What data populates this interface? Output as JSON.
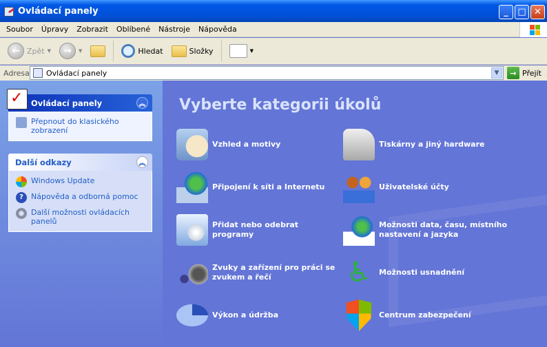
{
  "window": {
    "title": "Ovládací panely"
  },
  "menu": [
    "Soubor",
    "Úpravy",
    "Zobrazit",
    "Oblíbené",
    "Nástroje",
    "Nápověda"
  ],
  "toolbar": {
    "back": "Zpět",
    "search": "Hledat",
    "folders": "Složky"
  },
  "address": {
    "label": "Adresa",
    "value": "Ovládací panely",
    "go": "Přejít"
  },
  "sidebar": {
    "panel1": {
      "title": "Ovládací panely",
      "links": [
        "Přepnout do klasického zobrazení"
      ]
    },
    "panel2": {
      "title": "Další odkazy",
      "links": [
        "Windows Update",
        "Nápověda a odborná pomoc",
        "Další možnosti ovládacích panelů"
      ]
    }
  },
  "main": {
    "title": "Vyberte kategorii úkolů",
    "categories": [
      "Vzhled a motivy",
      "Tiskárny a jiný hardware",
      "Připojení k síti a Internetu",
      "Uživatelské účty",
      "Přidat nebo odebrat programy",
      "Možnosti data, času, místního nastavení a jazyka",
      "Zvuky a zařízení pro práci se zvukem a řečí",
      "Možnosti usnadnění",
      "Výkon a údržba",
      "Centrum zabezpečení"
    ]
  }
}
